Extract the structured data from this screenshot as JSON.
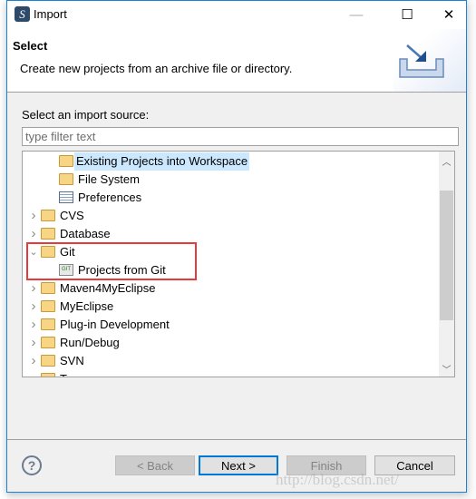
{
  "window": {
    "title": "Import",
    "minimize": "—",
    "maximize": "☐",
    "close": "✕"
  },
  "header": {
    "title": "Select",
    "description": "Create new projects from an archive file or directory."
  },
  "source_label": "Select an import source:",
  "filter": {
    "value": "",
    "placeholder": "type filter text"
  },
  "tree": [
    {
      "label": "Existing Projects into Workspace",
      "level": 1,
      "icon": "import-projects-icon",
      "selected": true
    },
    {
      "label": "File System",
      "level": 1,
      "icon": "folder-icon"
    },
    {
      "label": "Preferences",
      "level": 1,
      "icon": "preferences-icon"
    },
    {
      "label": "CVS",
      "level": 0,
      "icon": "folder-icon",
      "expanded": false
    },
    {
      "label": "Database",
      "level": 0,
      "icon": "folder-icon",
      "expanded": false
    },
    {
      "label": "Git",
      "level": 0,
      "icon": "folder-icon",
      "expanded": true
    },
    {
      "label": "Projects from Git",
      "level": 1,
      "icon": "git-icon"
    },
    {
      "label": "Maven4MyEclipse",
      "level": 0,
      "icon": "folder-icon",
      "expanded": false
    },
    {
      "label": "MyEclipse",
      "level": 0,
      "icon": "folder-icon",
      "expanded": false
    },
    {
      "label": "Plug-in Development",
      "level": 0,
      "icon": "folder-icon",
      "expanded": false
    },
    {
      "label": "Run/Debug",
      "level": 0,
      "icon": "folder-icon",
      "expanded": false
    },
    {
      "label": "SVN",
      "level": 0,
      "icon": "folder-icon",
      "expanded": false
    },
    {
      "label": "T...",
      "level": 0,
      "icon": "folder-icon",
      "expanded": false
    }
  ],
  "buttons": {
    "back": "< Back",
    "next": "Next >",
    "finish": "Finish",
    "cancel": "Cancel",
    "help": "?"
  },
  "watermark": "http://blog.csdn.net/",
  "colors": {
    "accent": "#0078d7",
    "highlight_box": "#e83a3a",
    "selection": "#cce8ff"
  }
}
